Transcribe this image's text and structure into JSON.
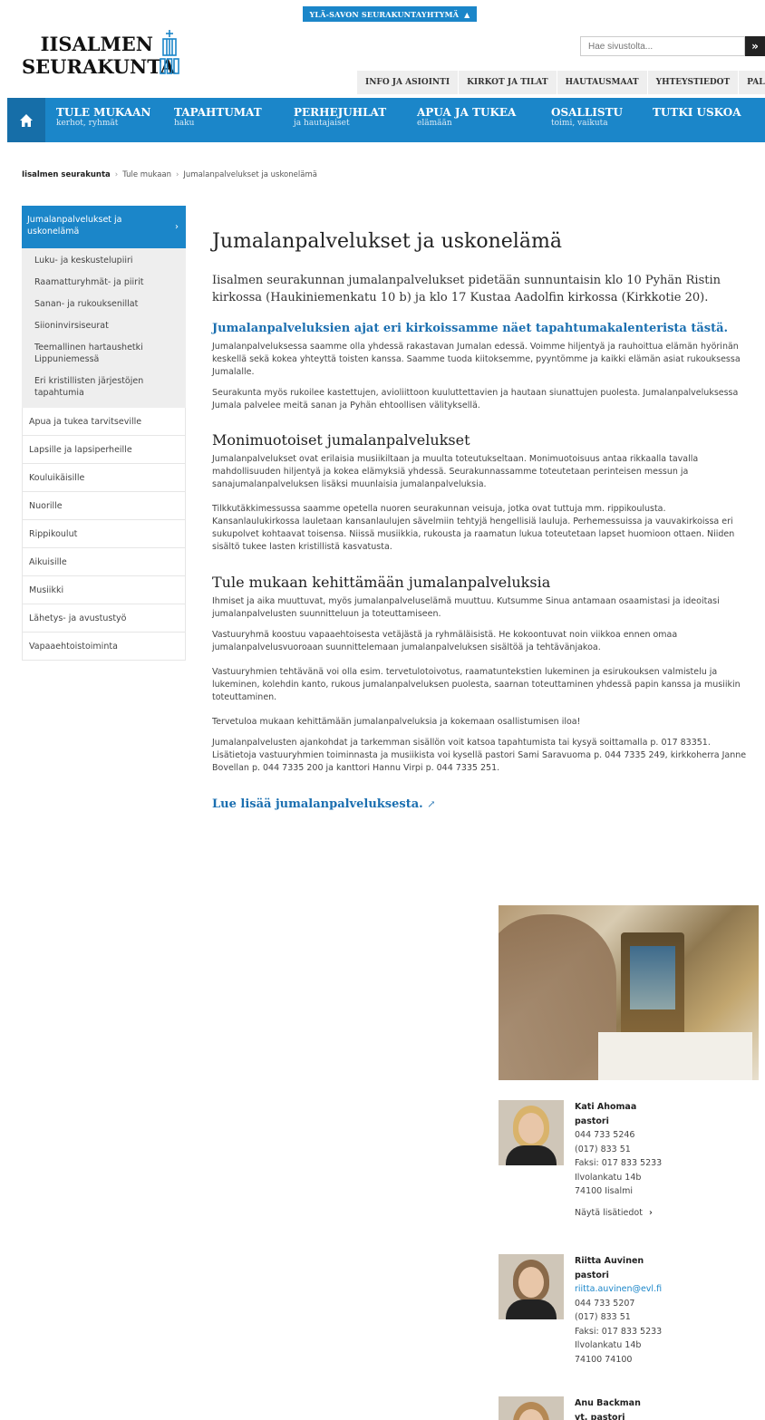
{
  "topbar": {
    "label": "YLÄ-SAVON SEURAKUNTAYHTYMÄ"
  },
  "logo": {
    "line1": "IISALMEN",
    "line2": "SEURAKUNTA"
  },
  "search": {
    "placeholder": "Hae sivustolta...",
    "button": "»"
  },
  "utility_nav": [
    "INFO JA ASIOINTI",
    "KIRKOT JA TILAT",
    "HAUTAUSMAAT",
    "YHTEYSTIEDOT",
    "PALAUTE"
  ],
  "main_nav": [
    {
      "title": "TULE MUKAAN",
      "sub": "kerhot, ryhmät"
    },
    {
      "title": "TAPAHTUMAT",
      "sub": "haku"
    },
    {
      "title": "PERHEJUHLAT",
      "sub": "ja hautajaiset"
    },
    {
      "title": "APUA JA TUKEA",
      "sub": "elämään"
    },
    {
      "title": "OSALLISTU",
      "sub": "toimi, vaikuta"
    },
    {
      "title": "TUTKI USKOA",
      "sub": ""
    }
  ],
  "breadcrumb": {
    "home": "Iisalmen seurakunta",
    "level1": "Tule mukaan",
    "level2": "Jumalanpalvelukset ja uskonelämä"
  },
  "sidebar": {
    "active": "Jumalanpalvelukset ja uskonelämä",
    "sub_items": [
      "Luku- ja keskustelupiiri",
      "Raamatturyhmät- ja piirit",
      "Sanan- ja rukouksenillat",
      "Siioninvirsiseurat",
      "Teemallinen hartaushetki Lippuniemessä",
      "Eri kristillisten järjestöjen tapahtumia"
    ],
    "items": [
      "Apua ja tukea tarvitseville",
      "Lapsille ja lapsiperheille",
      "Kouluikäisille",
      "Nuorille",
      "Rippikoulut",
      "Aikuisille",
      "Musiikki",
      "Lähetys- ja avustustyö",
      "Vapaaehtoistoiminta"
    ]
  },
  "content": {
    "title": "Jumalanpalvelukset ja uskonelämä",
    "lead": "Iisalmen seurakunnan jumalanpalvelukset pidetään sunnuntaisin klo 10 Pyhän Ristin kirkossa (Haukiniemenkatu 10 b) ja klo 17 Kustaa Aadolfin kirkossa (Kirkkotie 20).",
    "calendar_link": "Jumalanpalveluksien ajat eri kirkoissamme näet tapahtumakalenterista tästä.",
    "p1": "Jumalanpalveluksessa saamme olla yhdessä rakastavan Jumalan edessä. Voimme hiljentyä ja rauhoittua elämän hyörinän keskellä sekä kokea yhteyttä toisten kanssa. Saamme tuoda kiitoksemme, pyyntömme ja kaikki elämän asiat rukouksessa Jumalalle.",
    "p2": "Seurakunta myös rukoilee kastettujen, avioliittoon kuuluttettavien ja hautaan siunattujen puolesta. Jumalanpalveluksessa Jumala palvelee meitä sanan ja Pyhän ehtoollisen välityksellä.",
    "h2a": "Monimuotoiset jumalanpalvelukset",
    "p3": "Jumalanpalvelukset ovat erilaisia musiikiltaan ja muulta toteutukseltaan. Monimuotoisuus antaa rikkaalla tavalla mahdollisuuden hiljentyä ja kokea elämyksiä yhdessä. Seurakunnassamme toteutetaan perinteisen messun ja sanajumalanpalveluksen lisäksi muunlaisia jumalanpalveluksia.",
    "p4": "Tilkkutäkkimessussa saamme opetella nuoren seurakunnan veisuja, jotka ovat tuttuja mm. rippikoulusta. Kansanlaulukirkossa lauletaan kansanlaulujen sävelmiin tehtyjä hengellisiä lauluja. Perhemessuissa ja vauvakirkoissa eri sukupolvet kohtaavat toisensa. Niissä musiikkia, rukousta ja raamatun lukua toteutetaan lapset huomioon ottaen. Niiden sisältö tukee lasten kristillistä kasvatusta.",
    "h2b": "Tule mukaan kehittämään jumalanpalveluksia",
    "p5": "Ihmiset ja aika muuttuvat, myös jumalanpalveluselämä muuttuu. Kutsumme Sinua antamaan osaamistasi ja ideoitasi jumalanpalvelusten suunnitteluun ja toteuttamiseen.",
    "p6": "Vastuuryhmä koostuu vapaaehtoisesta vetäjästä ja ryhmäläisistä. He kokoontuvat noin viikkoa ennen omaa jumalanpalvelusvuoroaan suunnittelemaan jumalanpalveluksen sisältöä ja tehtävänjakoa.",
    "p7": "Vastuuryhmien tehtävänä voi olla esim. tervetulotoivotus, raamatuntekstien lukeminen ja esirukouksen valmistelu ja lukeminen, kolehdin kanto, rukous jumalanpalveluksen puolesta, saarnan toteuttaminen yhdessä papin kanssa ja musiikin toteuttaminen.",
    "p8": "Tervetuloa mukaan kehittämään jumalanpalveluksia ja kokemaan osallistumisen iloa!",
    "p9": "Jumalanpalvelusten ajankohdat ja tarkemman sisällön voit katsoa tapahtumista tai kysyä soittamalla p. 017 83351. Lisätietoja vastuuryhmien toiminnasta ja musiikista voi kysellä pastori Sami Saravuoma p. 044 7335 249, kirkkoherra Janne Bovellan p. 044 7335 200 ja kanttori Hannu Virpi p. 044 7335 251.",
    "read_more": "Lue lisää jumalanpalveluksesta."
  },
  "contacts": [
    {
      "name": "Kati Ahomaa",
      "title": "pastori",
      "email": "",
      "phone1": "044 733 5246",
      "phone2": "(017) 833 51",
      "fax": "Faksi: 017 833 5233",
      "street": "Ilvolankatu 14b",
      "city": "74100 Iisalmi",
      "more": "Näytä lisätiedot"
    },
    {
      "name": "Riitta Auvinen",
      "title": "pastori",
      "email": "riitta.auvinen@evl.fi",
      "phone1": "044 733 5207",
      "phone2": "(017) 833 51",
      "fax": "Faksi: 017 833 5233",
      "street": "Ilvolankatu 14b",
      "city": "74100 74100"
    },
    {
      "name": "Anu Backman",
      "title": "vt. pastori"
    }
  ],
  "colors": {
    "brand_blue": "#1b86c9",
    "link_blue": "#1b6fb0",
    "nav_dark": "#166ea8"
  },
  "icons": {
    "home": "home-icon",
    "external": "external-link-icon",
    "chevron": "chevron-right-icon"
  }
}
